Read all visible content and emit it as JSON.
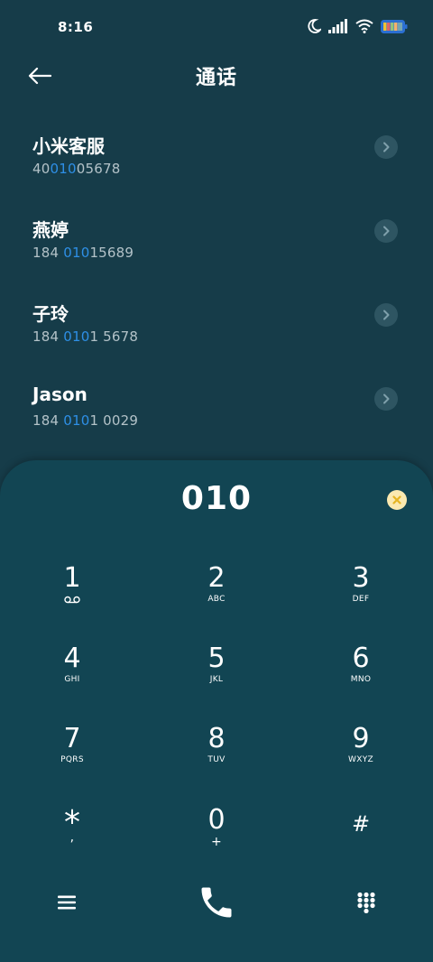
{
  "status_bar": {
    "time": "8:16"
  },
  "header": {
    "title": "通话"
  },
  "contacts": [
    {
      "name": "小米客服",
      "number_prefix": "40",
      "number_match": "010",
      "number_suffix": "05678"
    },
    {
      "name": "燕婷",
      "number_prefix": "184 ",
      "number_match": "010",
      "number_suffix": "15689"
    },
    {
      "name": "子玲",
      "number_prefix": "184 ",
      "number_match": "010",
      "number_suffix": "1 5678"
    },
    {
      "name": "Jason",
      "number_prefix": "184 ",
      "number_match": "010",
      "number_suffix": "1 0029"
    }
  ],
  "dialpad": {
    "dialed_number": "010",
    "keys": [
      {
        "digit": "1",
        "sub": ""
      },
      {
        "digit": "2",
        "sub": "ABC"
      },
      {
        "digit": "3",
        "sub": "DEF"
      },
      {
        "digit": "4",
        "sub": "GHI"
      },
      {
        "digit": "5",
        "sub": "JKL"
      },
      {
        "digit": "6",
        "sub": "MNO"
      },
      {
        "digit": "7",
        "sub": "PQRS"
      },
      {
        "digit": "8",
        "sub": "TUV"
      },
      {
        "digit": "9",
        "sub": "WXYZ"
      },
      {
        "digit": "*",
        "sub": ","
      },
      {
        "digit": "0",
        "sub": "+"
      },
      {
        "digit": "#",
        "sub": ""
      }
    ]
  },
  "colors": {
    "background": "#163c49",
    "dialpad_background": "#124553",
    "match_highlight": "#2e8fe6",
    "clear_button": "#fbe9b0"
  },
  "icons": {
    "back": "arrow-left-icon",
    "contact_detail": "chevron-right-icon",
    "clear": "close-icon",
    "voicemail": "voicemail-icon",
    "menu": "menu-icon",
    "call": "phone-icon",
    "keypad": "dialpad-icon"
  }
}
